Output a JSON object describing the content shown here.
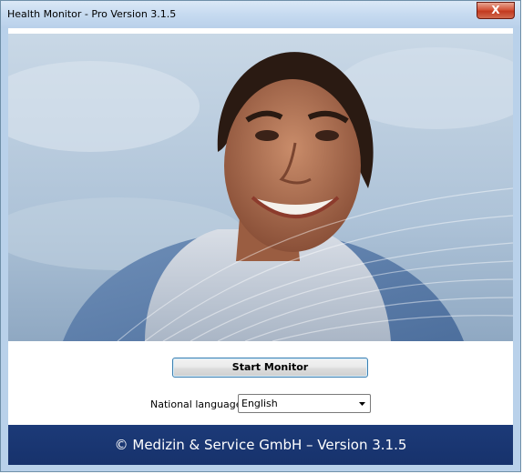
{
  "window": {
    "title": "Health Monitor - Pro Version 3.1.5",
    "close_glyph": "X"
  },
  "main": {
    "start_button_label": "Start Monitor",
    "language_label": "National language:",
    "language_selected": "English",
    "dropdown_icon": "chevron-down-icon"
  },
  "footer": {
    "text": "© Medizin & Service GmbH – Version 3.1.5",
    "background_color": "#1c3a78"
  },
  "colors": {
    "titlebar": "#c6daf0",
    "close_button": "#c23a20"
  }
}
